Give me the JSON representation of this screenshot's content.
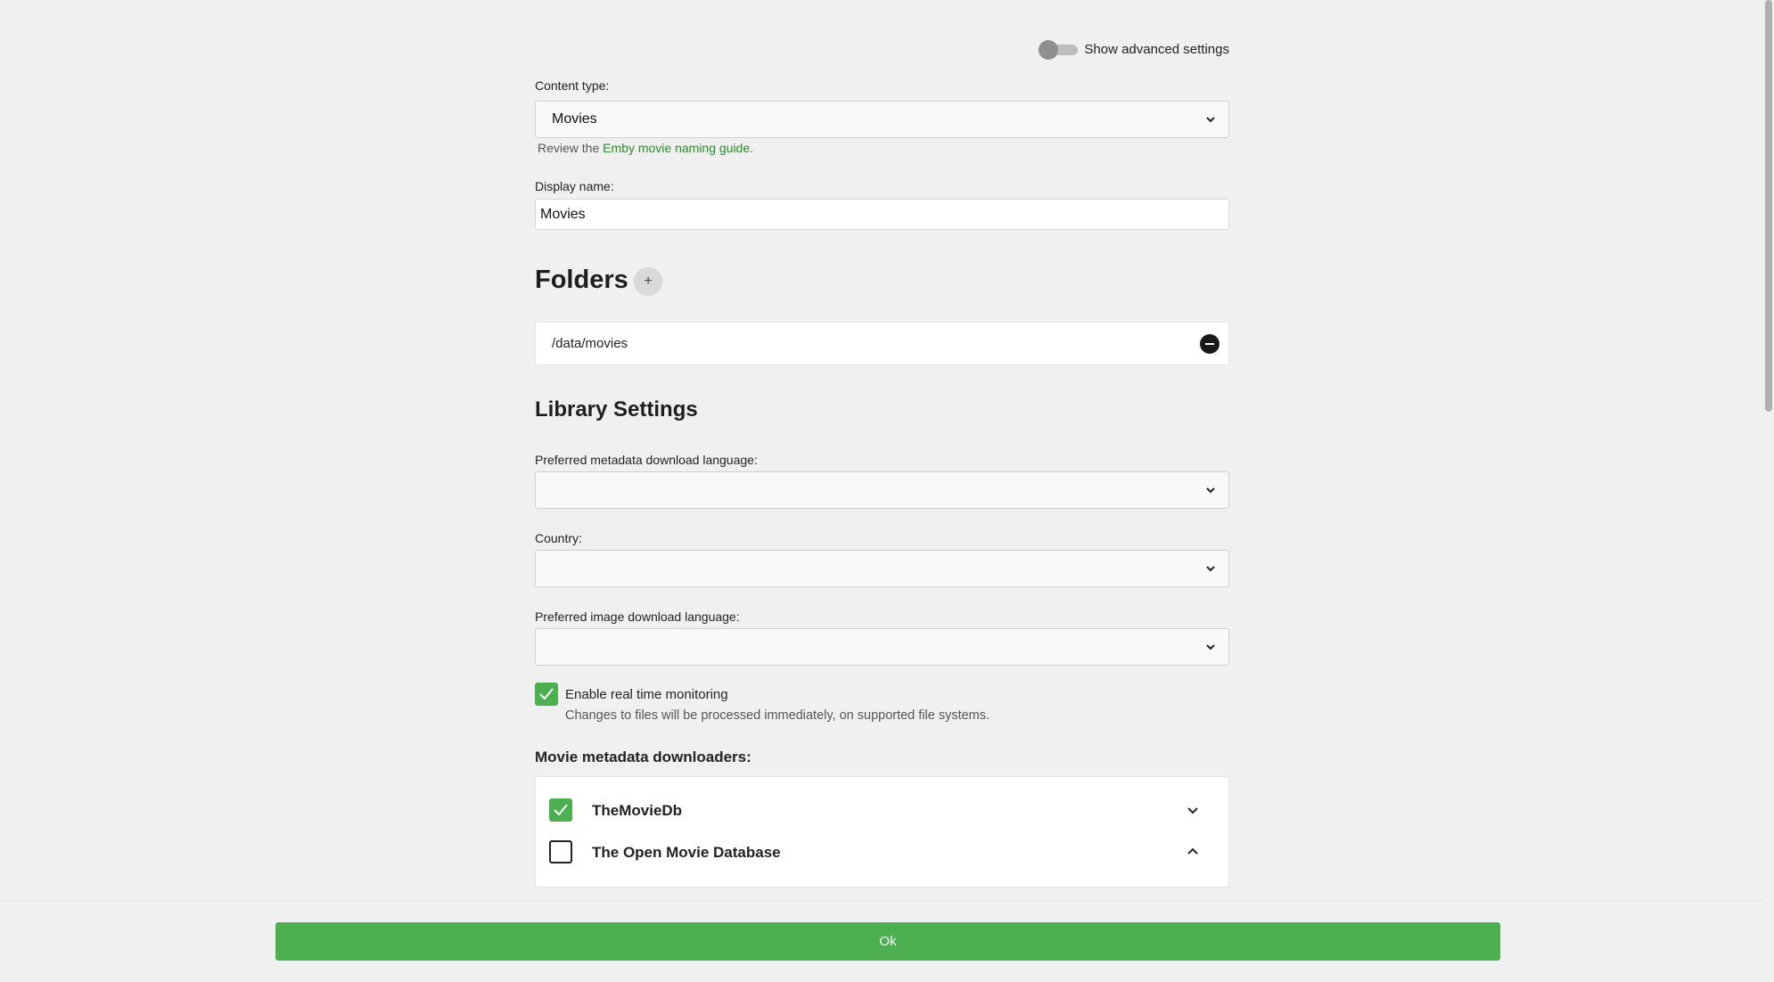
{
  "advanced": {
    "label": "Show advanced settings",
    "enabled": false
  },
  "content_type": {
    "label": "Content type:",
    "value": "Movies",
    "helper_prefix": "Review the ",
    "helper_link": "Emby movie naming guide",
    "helper_suffix": "."
  },
  "display_name": {
    "label": "Display name:",
    "value": "Movies"
  },
  "folders": {
    "title": "Folders",
    "add_label": "+",
    "items": [
      "/data/movies"
    ]
  },
  "library_settings": {
    "title": "Library Settings",
    "metadata_language": {
      "label": "Preferred metadata download language:",
      "value": ""
    },
    "country": {
      "label": "Country:",
      "value": ""
    },
    "image_language": {
      "label": "Preferred image download language:",
      "value": ""
    },
    "realtime": {
      "label": "Enable real time monitoring",
      "description": "Changes to files will be processed immediately, on supported file systems.",
      "checked": true
    }
  },
  "downloaders": {
    "title": "Movie metadata downloaders:",
    "items": [
      {
        "name": "TheMovieDb",
        "checked": true,
        "expanded": false
      },
      {
        "name": "The Open Movie Database",
        "checked": false,
        "expanded": true
      }
    ]
  },
  "footer": {
    "ok_label": "Ok"
  },
  "colors": {
    "accent": "#4caf50",
    "link": "#2b8a2b",
    "background": "#f0f0f0"
  }
}
